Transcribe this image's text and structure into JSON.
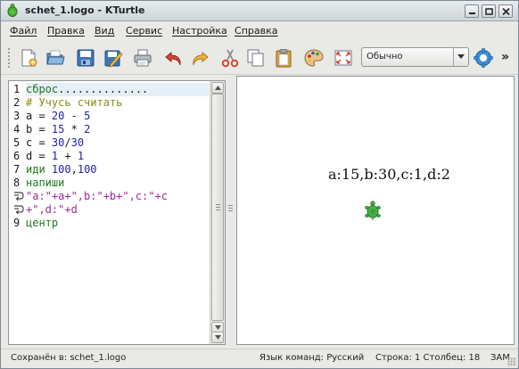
{
  "window": {
    "title": "schet_1.logo - KTurtle"
  },
  "menu": [
    {
      "label": "Файл"
    },
    {
      "label": "Правка"
    },
    {
      "label": "Вид"
    },
    {
      "label": "Сервис"
    },
    {
      "label": "Настройка"
    },
    {
      "label": "Справка"
    }
  ],
  "toolbar": {
    "buttons": [
      {
        "icon": "new-file-icon"
      },
      {
        "icon": "open-folder-icon"
      },
      {
        "icon": "save-icon"
      },
      {
        "icon": "save-as-icon"
      },
      {
        "icon": "print-icon"
      },
      {
        "icon": "undo-icon"
      },
      {
        "icon": "redo-icon"
      },
      {
        "icon": "cut-icon"
      },
      {
        "icon": "copy-icon"
      },
      {
        "icon": "paste-icon"
      },
      {
        "icon": "palette-icon"
      },
      {
        "icon": "fullscreen-icon"
      }
    ],
    "speed_value": "Обычно",
    "run_icon": "run-gear-icon",
    "more_label": "»"
  },
  "editor": {
    "lines": [
      {
        "num": "1",
        "text": "сброс",
        "trail": ".............."
      },
      {
        "num": "2",
        "text": "# Учусь считать"
      },
      {
        "num": "3",
        "parts": [
          "a",
          " = ",
          "20",
          " - ",
          "5"
        ]
      },
      {
        "num": "4",
        "parts": [
          "b",
          " = ",
          "15",
          " * ",
          "2"
        ]
      },
      {
        "num": "5",
        "parts": [
          "c",
          " = ",
          "30",
          "/",
          "30"
        ]
      },
      {
        "num": "6",
        "parts": [
          "d",
          " = ",
          "1",
          " + ",
          "1"
        ]
      },
      {
        "num": "7",
        "parts": [
          "иди",
          " ",
          "100",
          ",",
          "100"
        ]
      },
      {
        "num": "8",
        "text": "напиши",
        "cont1": "\"a:\"+a+\",b:\"+b+\",c:\"+c",
        "cont2": "+\",d:\"+d"
      },
      {
        "num": "9",
        "text": "центр"
      }
    ]
  },
  "canvas": {
    "output_text": "a:15,b:30,c:1,d:2"
  },
  "status": {
    "saved": "Сохранён в: schet_1.logo",
    "language": "Язык команд: Русский",
    "position": "Строка: 1 Столбец: 18",
    "mode": "ЗАМ"
  },
  "colors": {
    "keyword": "#1d7a1d",
    "comment": "#8a8a1a",
    "number": "#1f1fa8",
    "string": "#a0289a",
    "turtle": "#3fa83f"
  }
}
